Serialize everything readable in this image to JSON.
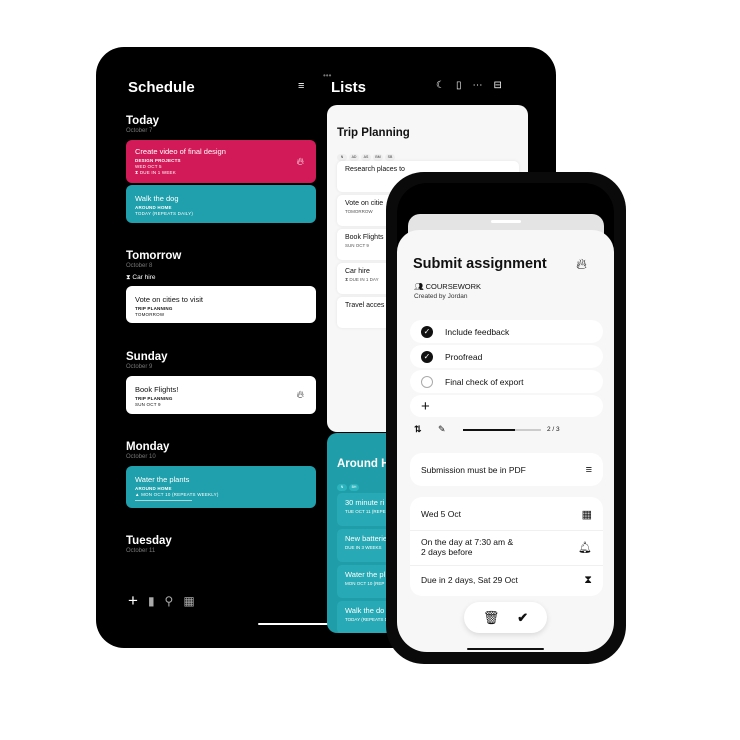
{
  "schedule": {
    "title": "Schedule",
    "days": [
      {
        "name": "Today",
        "date": "October 7"
      },
      {
        "name": "Tomorrow",
        "date": "October 8",
        "note": "Car hire"
      },
      {
        "name": "Sunday",
        "date": "October 9"
      },
      {
        "name": "Monday",
        "date": "October 10"
      },
      {
        "name": "Tuesday",
        "date": "October 11"
      }
    ],
    "tasks": [
      {
        "name": "Create video of final design",
        "list": "DESIGN PROJECTS",
        "due": "WED OCT 5",
        "extra": "DUE IN 1 WEEK"
      },
      {
        "name": "Walk the dog",
        "list": "AROUND HOME",
        "due": "TODAY (REPEATS DAILY)"
      },
      {
        "name": "Vote on cities to visit",
        "list": "TRIP PLANNING",
        "due": "TOMORROW"
      },
      {
        "name": "Book Flights!",
        "list": "TRIP PLANNING",
        "due": "SUN OCT 9"
      },
      {
        "name": "Water the plants",
        "list": "AROUND HOME",
        "due": "MON OCT 10 (REPEATS WEEKLY)"
      }
    ]
  },
  "lists": {
    "title": "Lists",
    "trip": {
      "title": "Trip Planning",
      "members": [
        "N",
        "AD",
        "AS",
        "BM",
        "SB"
      ],
      "items": [
        {
          "name": "Research places to",
          "sub": ""
        },
        {
          "name": "Vote on citie",
          "sub": "TOMORROW"
        },
        {
          "name": "Book Flights",
          "sub": "SUN OCT 9"
        },
        {
          "name": "Car hire",
          "sub": "DUE IN 1 DAY"
        },
        {
          "name": "Travel acces",
          "sub": ""
        }
      ]
    },
    "home": {
      "title": "Around H",
      "members": [
        "N",
        "BH"
      ],
      "items": [
        {
          "name": "30 minute ri",
          "sub": "TUE OCT 11 (REPE"
        },
        {
          "name": "New batterie",
          "sub": "DUE IN 3 WEEKS"
        },
        {
          "name": "Water the pl",
          "sub": "MON OCT 10 (REP"
        },
        {
          "name": "Walk the do",
          "sub": "TODAY (REPEATS D"
        }
      ]
    }
  },
  "detail": {
    "title": "Submit assignment",
    "list": "COURSEWORK",
    "created": "Created by Jordan",
    "subtasks": [
      {
        "label": "Include feedback",
        "done": true
      },
      {
        "label": "Proofread",
        "done": true
      },
      {
        "label": "Final check of export",
        "done": false
      }
    ],
    "progress": "2 / 3",
    "progress_fraction": 0.667,
    "notes": "Submission must be in PDF",
    "date": "Wed 5 Oct",
    "reminder_line1": "On the day at 7:30 am &",
    "reminder_line2": "2 days before",
    "deadline": "Due in 2 days, Sat 29 Oct"
  },
  "colors": {
    "pink": "#d31a58",
    "teal": "#1fa0ac"
  }
}
